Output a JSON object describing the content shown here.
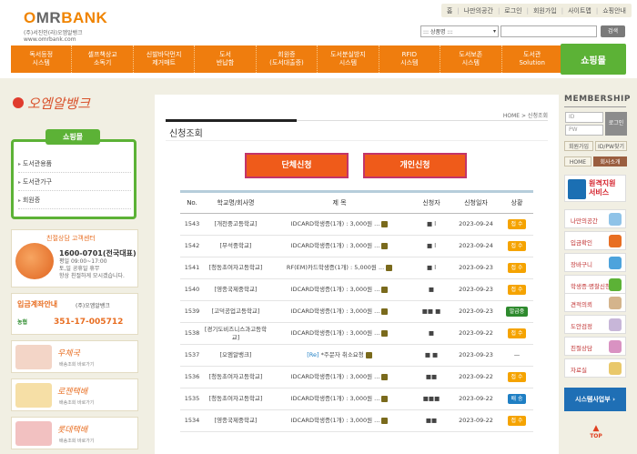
{
  "header": {
    "logo": {
      "text_o": "O",
      "text_mr": "MR",
      "text_bank": "BANK",
      "sub": "(주)서진인(라)오엠알뱅크",
      "url": "www.omrbank.com"
    },
    "top_links": [
      "홈",
      "나만의공간",
      "로그인",
      "회원가입",
      "사이트맵",
      "쇼핑안내"
    ],
    "category_select": "::: 상품명 :::",
    "search_placeholder": "",
    "search_button": "검색"
  },
  "main_menu": [
    "독서등정\n시스템",
    "셀프책상교\n소독기",
    "신발바닥먼지\n제거매트",
    "도서\n반납함",
    "회원증\n(도서대출증)",
    "도서분실방지\n시스템",
    "RFID\n시스템",
    "도서보존\n시스템",
    "도서관\nSolution"
  ],
  "shop_tab": "쇼핑몰",
  "left": {
    "brand": "오엠알뱅크",
    "shopmall_title": "쇼핑몰",
    "shop_items": [
      "도서관용품",
      "도서관가구",
      "회원증"
    ],
    "cs": {
      "title": "친절상담 고객센터",
      "phone": "1600-0701(전국대표)",
      "hours1": "평일 09:00~17:00",
      "hours2": "토,일 공휴일 휴무",
      "hours3": "항상 친절하게 모시겠습니다."
    },
    "bank": {
      "title": "입금계좌안내",
      "owner": "(주)오엠알뱅크",
      "bank_name": "농협",
      "number": "351-17-005712"
    },
    "couriers": [
      {
        "name": "우체국",
        "link": "배송조회 바로가기"
      },
      {
        "name": "로젠택배",
        "link": "배송조회 바로가기"
      },
      {
        "name": "롯데택배",
        "link": "배송조회 바로가기"
      }
    ]
  },
  "content": {
    "breadcrumb": "HOME > 신청조회",
    "title": "신청조회",
    "btn_group": "단체신청",
    "btn_personal": "개인신청",
    "table": {
      "headers": [
        "No.",
        "학교명/회사명",
        "제 목",
        "신청자",
        "신청일자",
        "상황"
      ],
      "rows": [
        {
          "no": "1543",
          "school": "[개천중고등학교]",
          "subject": "IDCARD학생증(1개) : 3,000원 ...",
          "applicant": "■ l",
          "date": "2023-09-24",
          "status": "접 수",
          "status_color": "orange"
        },
        {
          "no": "1542",
          "school": "[무석중학교]",
          "subject": "IDCARD학생증(1개) : 3,000원 ...",
          "applicant": "■ l",
          "date": "2023-09-24",
          "status": "접 수",
          "status_color": "orange"
        },
        {
          "no": "1541",
          "school": "[청동초여자고등학교]",
          "subject": "RF(EM)카드학생증(1개) : 5,000원 ...",
          "applicant": "■ l",
          "date": "2023-09-23",
          "status": "접 수",
          "status_color": "orange"
        },
        {
          "no": "1540",
          "school": "[영종국제중학교]",
          "subject": "IDCARD학생증(1개) : 3,000원 ...",
          "applicant": "■",
          "date": "2023-09-23",
          "status": "접 수",
          "status_color": "orange"
        },
        {
          "no": "1539",
          "school": "[고덕공업고등학교]",
          "subject": "IDCARD학생증(1개) : 3,000원 ...",
          "applicant": "■■ ■",
          "date": "2023-09-23",
          "status": "발급중",
          "status_color": "green"
        },
        {
          "no": "1538",
          "school": "[경기도비즈니스과고등학교]",
          "subject": "IDCARD학생증(1개) : 3,000원 ...",
          "applicant": "■",
          "date": "2023-09-22",
          "status": "접 수",
          "status_color": "orange"
        },
        {
          "no": "1537",
          "school": "[오엠알뱅크]",
          "subject": "*주문자 취소요청",
          "re": "[Re]",
          "applicant": "■ ■",
          "date": "2023-09-23",
          "status": "—",
          "status_color": "none"
        },
        {
          "no": "1536",
          "school": "[청동초여자고등학교]",
          "subject": "IDCARD학생증(1개) : 3,000원 ...",
          "applicant": "■■",
          "date": "2023-09-22",
          "status": "접 수",
          "status_color": "orange"
        },
        {
          "no": "1535",
          "school": "[청동초여자고등학교]",
          "subject": "IDCARD학생증(1개) : 3,000원 ...",
          "applicant": "■■■",
          "date": "2023-09-22",
          "status": "배 송",
          "status_color": "blue"
        },
        {
          "no": "1534",
          "school": "[영종국제중학교]",
          "subject": "IDCARD학생증(1개) : 3,000원 ...",
          "applicant": "■■",
          "date": "2023-09-22",
          "status": "접 수",
          "status_color": "orange"
        }
      ]
    }
  },
  "right": {
    "membership": "MEMBERSHIP",
    "id_placeholder": "ID",
    "pw_placeholder": "PW",
    "login": "로그인",
    "join": "회원가입",
    "find": "ID/PW찾기",
    "home": "HOME",
    "company": "회사소개",
    "remote": "원격지원\n서비스",
    "quick": [
      "나만의공간",
      "입금확인",
      "장바구니",
      "학생증·명찰신청",
      "견적의뢰",
      "도안검정",
      "친절상담",
      "자료실"
    ],
    "sys_btn": "시스템사업부 ›",
    "top": "TOP"
  }
}
